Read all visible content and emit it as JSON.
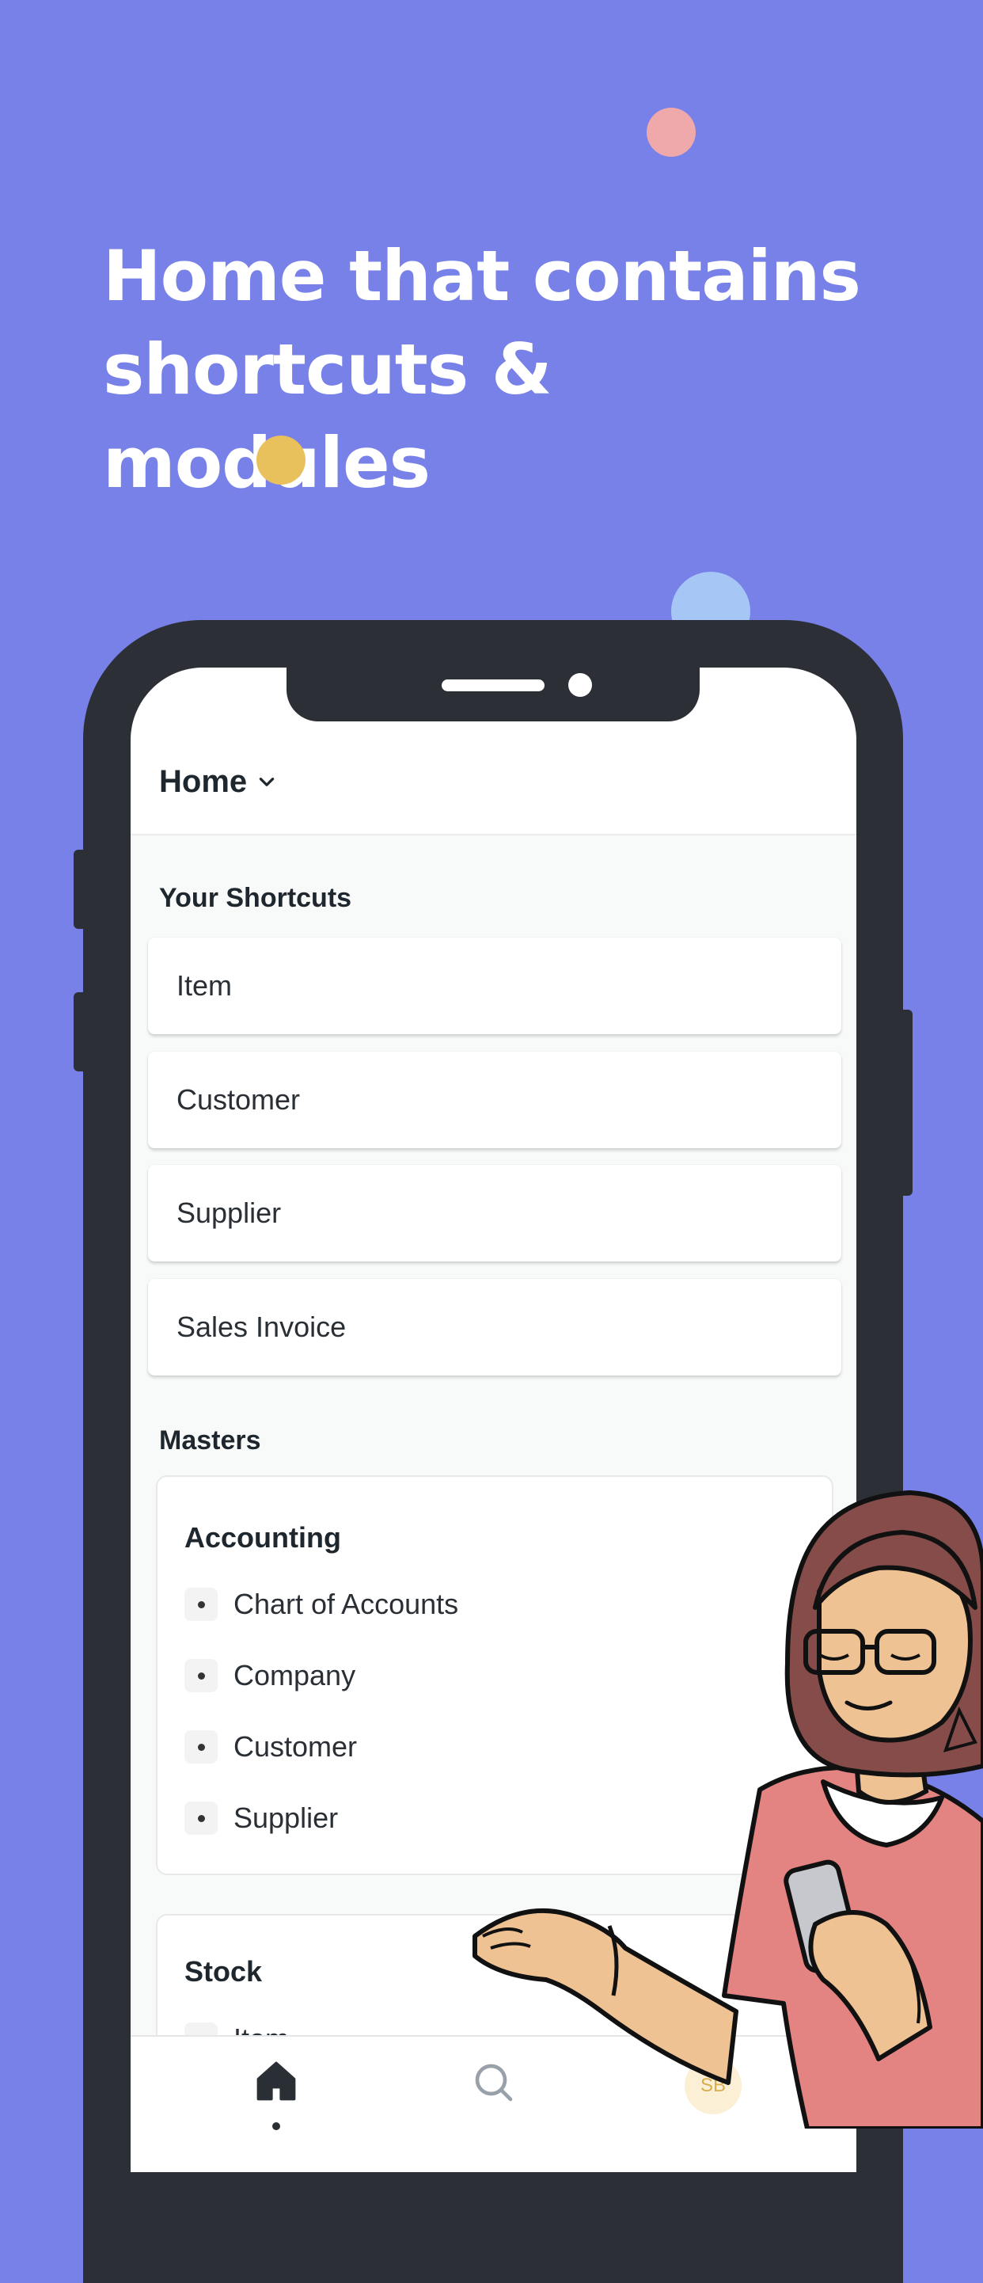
{
  "headline": {
    "line1": "Home that contains",
    "line2": "shortcuts & modules"
  },
  "app": {
    "title": "Home",
    "shortcuts_title": "Your Shortcuts",
    "shortcuts": [
      "Item",
      "Customer",
      "Supplier",
      "Sales Invoice"
    ],
    "masters_title": "Masters",
    "modules": [
      {
        "title": "Accounting",
        "links": [
          "Chart of Accounts",
          "Company",
          "Customer",
          "Supplier"
        ]
      },
      {
        "title": "Stock",
        "links": [
          "Item"
        ]
      }
    ],
    "tabbar": {
      "home_icon": "home-icon",
      "search_icon": "search-icon",
      "avatar_initials": "SB"
    }
  },
  "colors": {
    "background": "#7781e8",
    "phone_frame": "#2d2f36",
    "dot_pink": "#f0a9aa",
    "dot_yellow": "#e8c05c",
    "dot_blue": "#a6c6f6",
    "avatar_bg": "#fbf0d6",
    "avatar_text": "#d8ad4a"
  }
}
